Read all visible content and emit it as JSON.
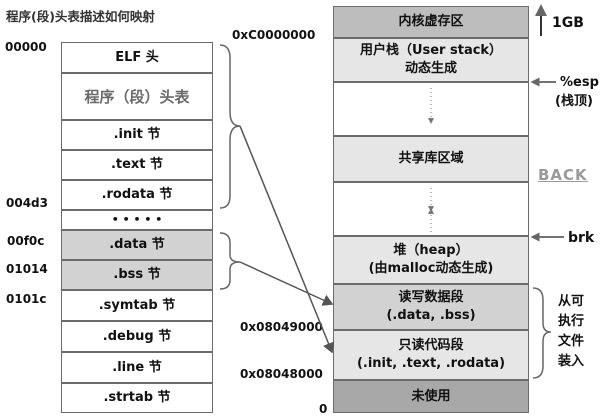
{
  "title": "程序(段)头表描述如何映射",
  "left_addresses": {
    "a0": "00000",
    "a1": "004d3",
    "a2": "00f0c",
    "a3": "01014",
    "a4": "0101c"
  },
  "elf_sections": {
    "elf_header": "ELF 头",
    "program_header": "程序（段）头表",
    "init": ".init 节",
    "text": ".text 节",
    "rodata": ".rodata 节",
    "ellipsis": "• • • • •",
    "data": ".data 节",
    "bss": ".bss 节",
    "symtab": ".symtab 节",
    "debug": ".debug 节",
    "line": ".line 节",
    "strtab": ".strtab 节"
  },
  "right_addresses": {
    "kernel_base": "0xC0000000",
    "data_start": "0x08049000",
    "code_start": "0x08048000",
    "zero": "0"
  },
  "memory_regions": {
    "kernel": "内核虚存区",
    "user_stack_1": "用户栈（User stack）",
    "user_stack_2": "动态生成",
    "shared_lib": "共享库区域",
    "heap_1": "堆（heap）",
    "heap_2": "(由malloc动态生成)",
    "rw_1": "读写数据段",
    "rw_2": "(.data, .bss)",
    "ro_1": "只读代码段",
    "ro_2": "(.init, .text, .rodata)",
    "unused": "未使用"
  },
  "annotations": {
    "one_gb": "1GB",
    "esp_1": "%esp",
    "esp_2": "(栈顶)",
    "back": "BACK",
    "brk": "brk",
    "load_1": "从可",
    "load_2": "执行",
    "load_3": "文件",
    "load_4": "装入"
  }
}
